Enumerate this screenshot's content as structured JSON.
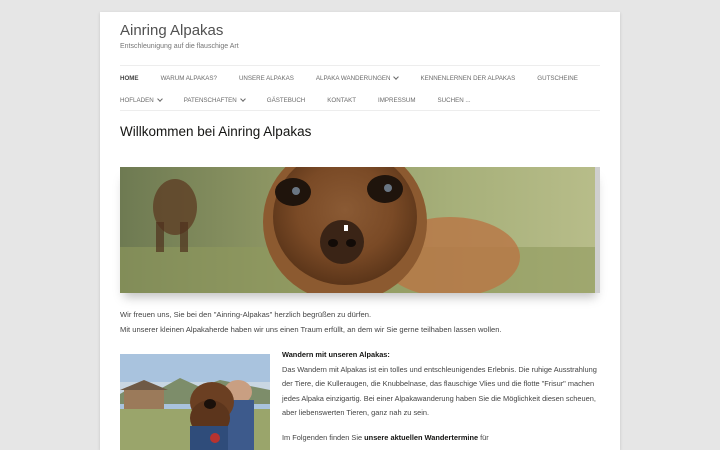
{
  "site": {
    "title": "Ainring Alpakas",
    "description": "Entschleunigung auf die flauschige Art"
  },
  "nav": {
    "row1": [
      {
        "label": "HOME",
        "active": true,
        "dropdown": false
      },
      {
        "label": "WARUM ALPAKAS?",
        "dropdown": false
      },
      {
        "label": "UNSERE ALPAKAS",
        "dropdown": false
      },
      {
        "label": "ALPAKA WANDERUNGEN",
        "dropdown": true
      },
      {
        "label": "KENNENLERNEN DER ALPAKAS",
        "dropdown": false
      },
      {
        "label": "GUTSCHEINE",
        "dropdown": false
      }
    ],
    "row2": [
      {
        "label": "HOFLADEN",
        "dropdown": true
      },
      {
        "label": "PATENSCHAFTEN",
        "dropdown": true
      },
      {
        "label": "GÄSTEBUCH",
        "dropdown": false
      },
      {
        "label": "KONTAKT",
        "dropdown": false
      },
      {
        "label": "IMPRESSUM",
        "dropdown": false
      },
      {
        "label": "SUCHEN ...",
        "dropdown": false
      }
    ]
  },
  "main": {
    "heading": "Willkommen bei Ainring Alpakas",
    "intro_line1": "Wir freuen uns, Sie bei den \"Ainring-Alpakas\" herzlich begrüßen zu dürfen.",
    "intro_line2": "Mit unserer kleinen Alpakaherde haben wir uns einen Traum erfüllt, an dem wir Sie gerne teilhaben lassen wollen.",
    "section": {
      "title": "Wandern mit unseren Alpakas:",
      "paragraph": "Das Wandern mit Alpakas ist ein tolles und entschleunigendes Erlebnis. Die ruhige Ausstrahlung der Tiere, die Kulleraugen, die Knubbelnase, das flauschige Vlies und die flotte \"Frisur\" machen jedes Alpaka einzigartig. Bei einer Alpakawanderung haben Sie die Möglichkeit diesen scheuen, aber liebenswerten Tieren, ganz nah zu sein.",
      "followup_prefix": "Im Folgenden finden Sie ",
      "followup_bold": "unsere aktuellen Wandertermine",
      "followup_suffix": " für"
    }
  }
}
